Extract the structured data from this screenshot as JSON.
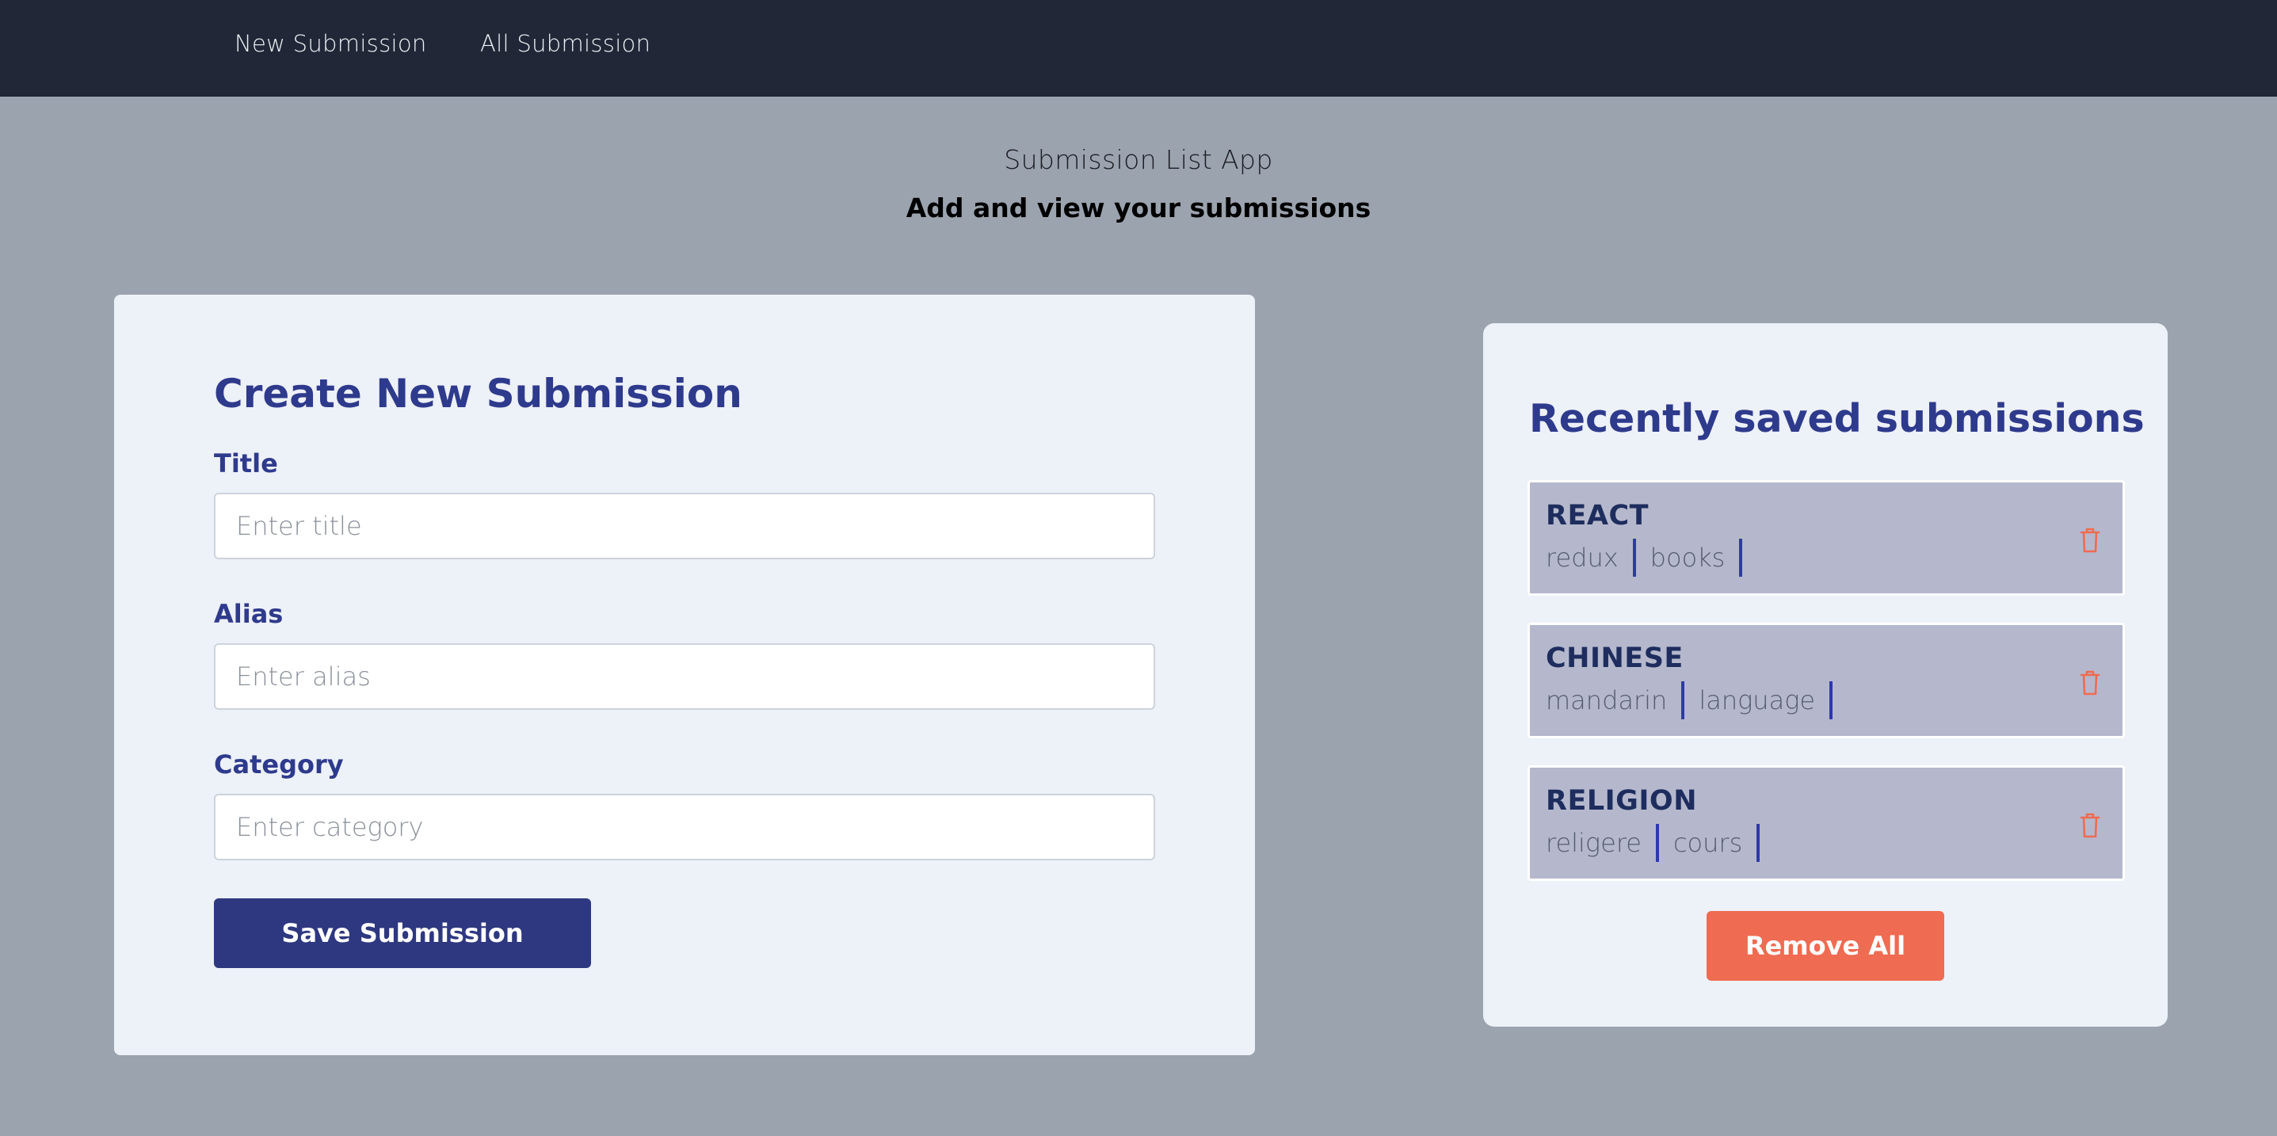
{
  "nav": {
    "items": [
      {
        "label": "New Submission"
      },
      {
        "label": "All Submission"
      }
    ]
  },
  "header": {
    "title": "Submission List App",
    "subtitle": "Add and view your submissions"
  },
  "form": {
    "heading": "Create New Submission",
    "title_label": "Title",
    "title_placeholder": "Enter title",
    "title_value": "",
    "alias_label": "Alias",
    "alias_placeholder": "Enter alias",
    "alias_value": "",
    "category_label": "Category",
    "category_placeholder": "Enter category",
    "category_value": "",
    "save_label": "Save Submission"
  },
  "list": {
    "heading": "Recently saved submissions",
    "items": [
      {
        "title": "REACT",
        "tags": [
          "redux",
          "books"
        ]
      },
      {
        "title": "CHINESE",
        "tags": [
          "mandarin",
          "language"
        ]
      },
      {
        "title": "RELIGION",
        "tags": [
          "religere",
          "cours"
        ]
      }
    ],
    "delete_icon": "trash-icon",
    "remove_all_label": "Remove All"
  },
  "colors": {
    "navbar_bg": "#212736",
    "page_bg": "#9ba3ae",
    "card_bg": "#edf1f8",
    "heading": "#2e3a8c",
    "primary_button": "#2e3880",
    "danger_button": "#ef6b51",
    "item_bg": "#b5b8cc",
    "tag_divider": "#2e3aa8"
  }
}
